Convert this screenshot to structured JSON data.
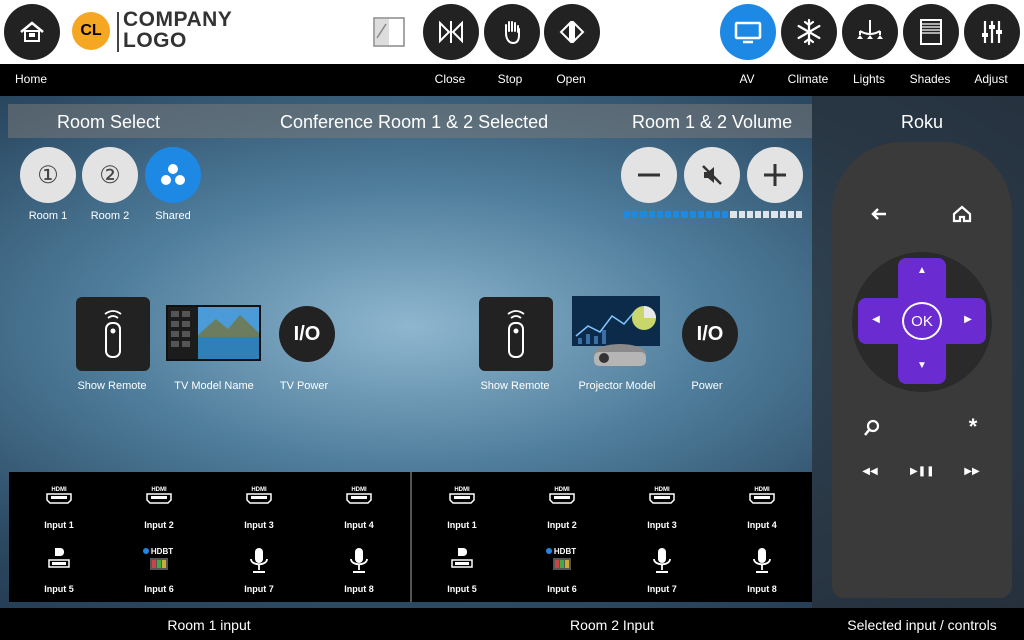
{
  "header": {
    "logo_initials": "CL",
    "logo_line1": "COMPANY",
    "logo_line2": "LOGO",
    "nav_left": "Home",
    "shade_controls": [
      {
        "label": "Close",
        "icon": "shade-close-icon"
      },
      {
        "label": "Stop",
        "icon": "hand-stop-icon"
      },
      {
        "label": "Open",
        "icon": "shade-open-icon"
      }
    ],
    "tabs": [
      {
        "label": "AV",
        "icon": "monitor-icon",
        "active": true
      },
      {
        "label": "Climate",
        "icon": "snowflake-icon",
        "active": false
      },
      {
        "label": "Lights",
        "icon": "chandelier-icon",
        "active": false
      },
      {
        "label": "Shades",
        "icon": "shade-icon",
        "active": false
      },
      {
        "label": "Adjust",
        "icon": "sliders-icon",
        "active": false
      }
    ]
  },
  "room_select": {
    "title": "Room Select",
    "status": "Conference Room 1 & 2 Selected",
    "rooms": [
      {
        "label": "Room 1",
        "glyph": "①"
      },
      {
        "label": "Room 2",
        "glyph": "②"
      },
      {
        "label": "Shared",
        "glyph": ""
      }
    ]
  },
  "volume": {
    "title": "Room 1 & 2 Volume",
    "level_fraction": 0.6
  },
  "room1_devices": {
    "remote_label": "Show Remote",
    "display_label": "TV Model Name",
    "power_label": "TV Power",
    "power_glyph": "I/O"
  },
  "room2_devices": {
    "remote_label": "Show Remote",
    "display_label": "Projector Model",
    "power_label": "Power",
    "power_glyph": "I/O"
  },
  "room1_inputs": [
    "Input 1",
    "Input 2",
    "Input 3",
    "Input 4",
    "Input 5",
    "Input 6",
    "Input 7",
    "Input 8"
  ],
  "room2_inputs": [
    "Input 1",
    "Input 2",
    "Input 3",
    "Input 4",
    "Input 5",
    "Input 6",
    "Input 7",
    "Input 8"
  ],
  "input_badges": {
    "hdmi": "HDMI",
    "hdbt": "HDBT"
  },
  "roku": {
    "title": "Roku",
    "ok_label": "OK",
    "accent": "#6a2bd0"
  },
  "footer": {
    "room1": "Room 1 input",
    "room2": "Room 2 Input",
    "controls": "Selected input / controls"
  },
  "colors": {
    "accent": "#1e88e5",
    "logo": "#f5a623"
  }
}
